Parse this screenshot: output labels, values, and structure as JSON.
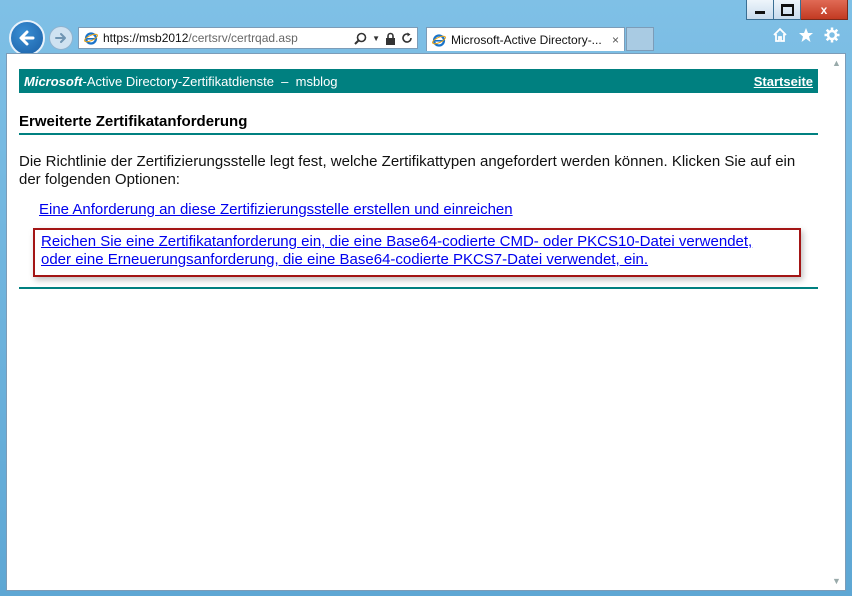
{
  "browser": {
    "url_host": "https://msb2012",
    "url_path": "/certsrv/certrqad.asp",
    "tab_title": "Microsoft-Active Directory-...",
    "tab_close": "×",
    "window_min": "",
    "window_max": "",
    "window_close": "x",
    "icons": [
      "back-arrow-icon",
      "forward-arrow-icon",
      "ie-logo-icon",
      "search-icon",
      "lock-icon",
      "refresh-icon",
      "home-icon",
      "favorites-star-icon",
      "settings-gear-icon"
    ]
  },
  "page": {
    "banner_brand": "Microsoft",
    "banner_title": "-Active Directory-Zertifikatdienste  –  msblog",
    "home_link": "Startseite",
    "heading": "Erweiterte Zertifikatanforderung",
    "description": "Die Richtlinie der Zertifizierungsstelle legt fest, welche Zertifikattypen angefordert werden können. Klicken Sie auf ein der folgenden Optionen:",
    "link_create": "Eine Anforderung an diese Zertifizierungsstelle erstellen und einreichen",
    "link_submit_line1": "Reichen Sie eine Zertifikatanforderung ein, die eine Base64-codierte CMD- oder PKCS10-Datei verwendet,",
    "link_submit_line2": "oder eine Erneuerungsanforderung, die eine Base64-codierte PKCS7-Datei verwendet, ein."
  },
  "colors": {
    "banner": "#008080",
    "link": "#0000ee",
    "highlight_border": "#a31515"
  }
}
